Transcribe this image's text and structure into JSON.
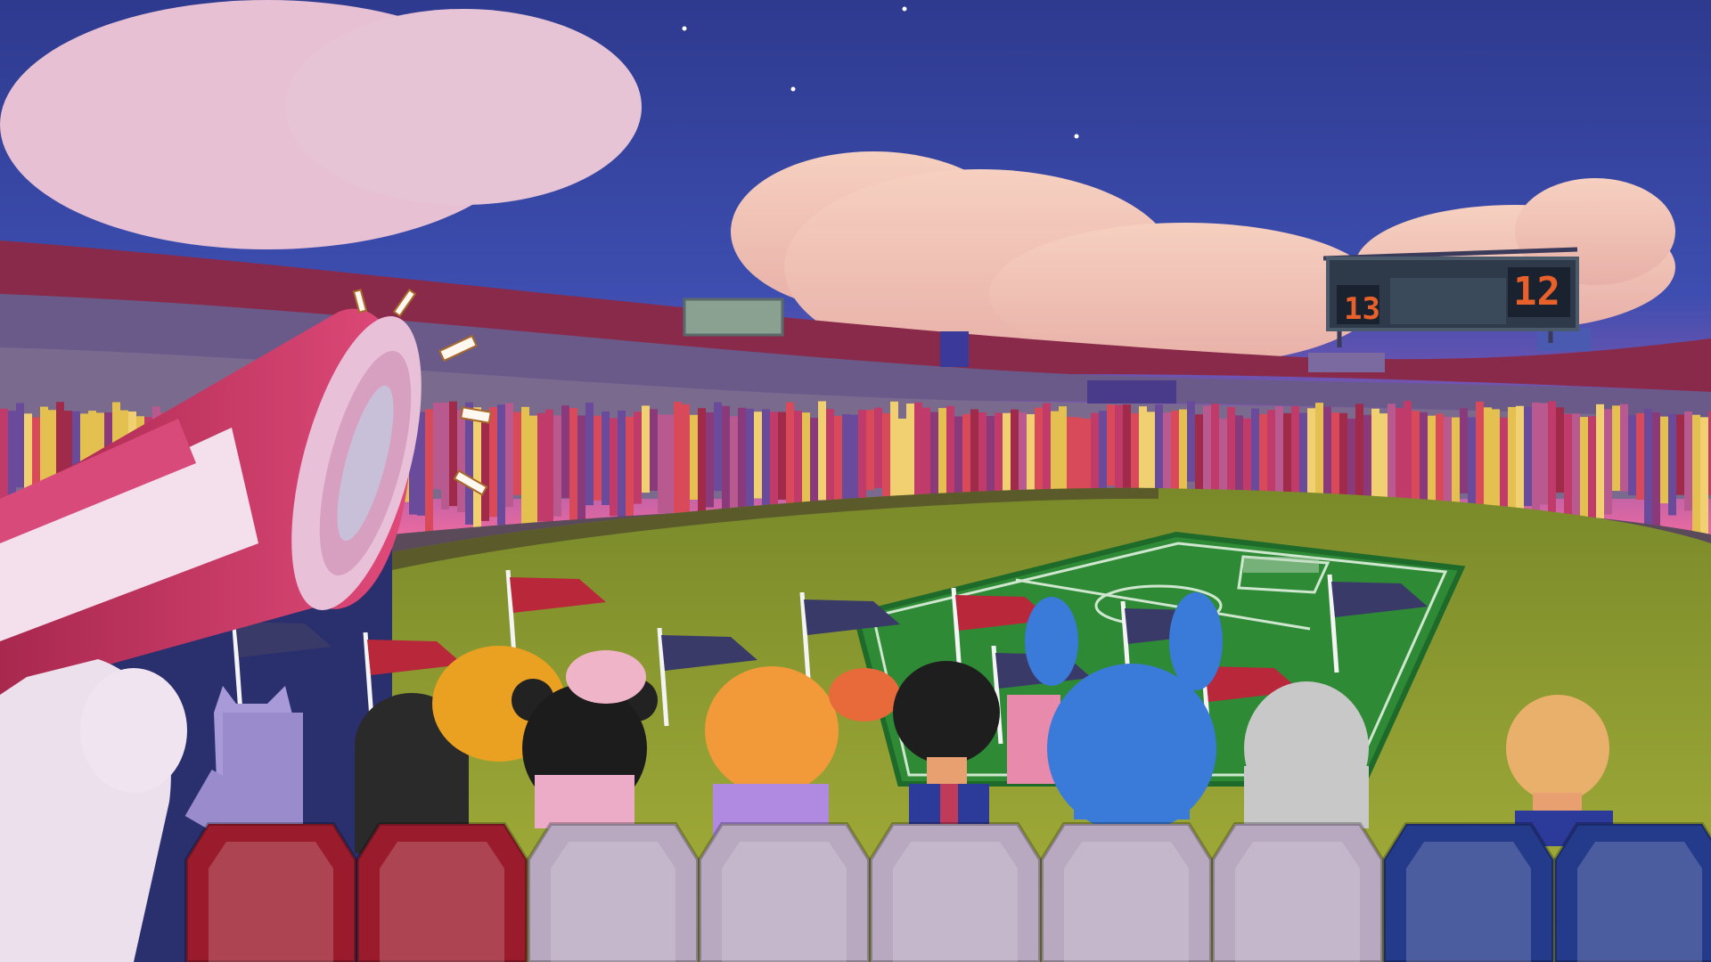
{
  "scoreboard": {
    "home_score": "13",
    "away_score": "12"
  },
  "colors": {
    "sky_top": "#3a4aa8",
    "sky_horizon": "#e06aa8",
    "cloud": "#f2c4b8",
    "pitch": "#2f8a36",
    "field_outer": "#8aa23a",
    "seat_red": "#9a1c2c",
    "seat_gray": "#b8a8c0",
    "seat_blue": "#243a8a",
    "megaphone": "#c83a6a",
    "flag_red": "#b8283a",
    "flag_navy": "#3a3a68"
  },
  "icons": {
    "megaphone": "megaphone-icon",
    "pennant": "pennant-flag-icon",
    "star": "star-icon"
  }
}
